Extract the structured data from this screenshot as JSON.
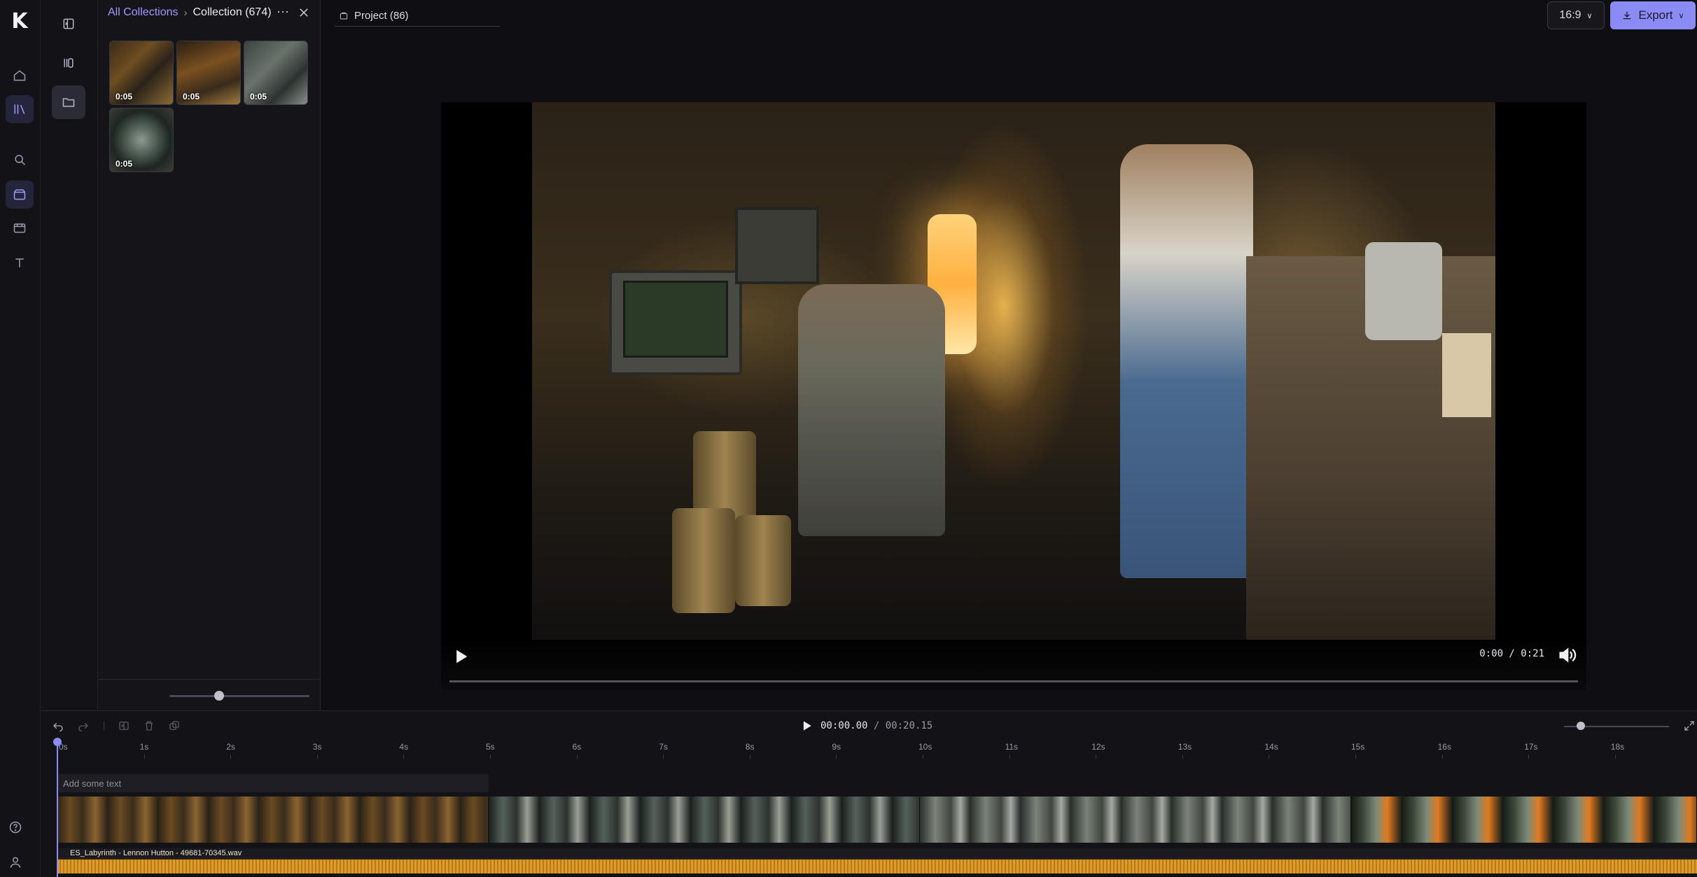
{
  "app": {
    "logo_letter": "K"
  },
  "breadcrumb": {
    "root": "All Collections",
    "current": "Collection (674)"
  },
  "panel": {
    "more_label": "⋯",
    "thumbnails": [
      {
        "duration": "0:05",
        "style": "warm"
      },
      {
        "duration": "0:05",
        "style": "warm2"
      },
      {
        "duration": "0:05",
        "style": "gray"
      },
      {
        "duration": "0:05",
        "style": "round"
      }
    ]
  },
  "project_tab": {
    "label": "Project (86)"
  },
  "toolbar": {
    "aspect_ratio": "16:9",
    "export_label": "Export"
  },
  "player": {
    "time": "0:00 / 0:21"
  },
  "timeline": {
    "current_time": "00:00.00",
    "separator": "/",
    "total_time": "00:20.15",
    "ruler_ticks": [
      "0s",
      "1s",
      "2s",
      "3s",
      "4s",
      "5s",
      "6s",
      "7s",
      "8s",
      "9s",
      "10s",
      "11s",
      "12s",
      "13s",
      "14s",
      "15s",
      "16s",
      "17s",
      "18s"
    ],
    "text_track_placeholder": "Add some text",
    "audio_clip_name": "ES_Labyrinth - Lennon Hutton - 49681-70345.wav"
  },
  "colors": {
    "accent": "#8b8bf5",
    "background": "#0e0e13",
    "audio": "#e09a28"
  }
}
